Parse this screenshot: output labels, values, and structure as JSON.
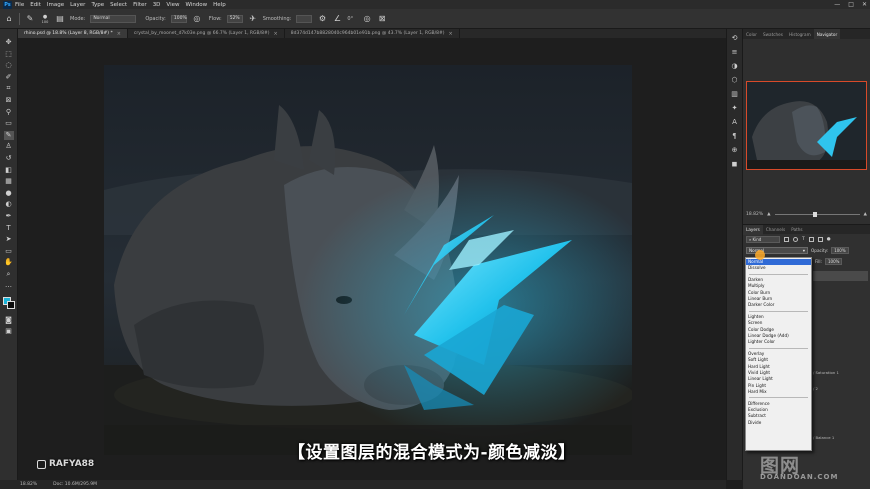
{
  "app": {
    "logo": "Ps"
  },
  "menu": [
    "File",
    "Edit",
    "Image",
    "Layer",
    "Type",
    "Select",
    "Filter",
    "3D",
    "View",
    "Window",
    "Help"
  ],
  "window_controls": [
    "—",
    "□",
    "✕"
  ],
  "options_bar": {
    "brush_size": "100",
    "mode_label": "Mode:",
    "mode_value": "Normal",
    "opacity_label": "Opacity:",
    "opacity_value": "100%",
    "flow_label": "Flow:",
    "flow_value": "52%",
    "smoothing_label": "Smoothing:",
    "smoothing_value": "",
    "angle_value": "0°"
  },
  "tabs": [
    {
      "label": "rhino.psd @ 18.8% (Layer 8, RGB/8#) *",
      "active": true
    },
    {
      "label": "crystal_by_moonet_d7k03e.png @ 66.7% (Layer 1, RGB/8#)",
      "active": false
    },
    {
      "label": "8d374d147b8828040c964b01e91b.png @ 43.7% (Layer 1, RGB/8#)",
      "active": false
    }
  ],
  "status": {
    "zoom": "18.82%",
    "doc": "Doc: 10.6M/295.9M"
  },
  "subtitle": "【设置图层的混合模式为-颜色减淡】",
  "watermark": "RAFYA88",
  "right_panel": {
    "top_tabs": [
      "Color",
      "Swatches",
      "Histogram",
      "Navigator"
    ],
    "active_top_tab": "Navigator",
    "zoom_value": "18.82%",
    "layer_tabs": [
      "Layers",
      "Channels",
      "Paths"
    ],
    "filter_kind": "Kind",
    "blend_mode": "Normal",
    "opacity_label": "Opacity:",
    "opacity_value": "100%",
    "fill_label": "Fill:",
    "fill_value": "100%",
    "lock_label": "Lock:",
    "layer_stubs": [
      "/ Saturation 1",
      "/ 2",
      "/ Balance 1"
    ]
  },
  "blend_menu": {
    "groups": [
      [
        "Normal",
        "Dissolve"
      ],
      [
        "Darken",
        "Multiply",
        "Color Burn",
        "Linear Burn",
        "Darker Color"
      ],
      [
        "Lighten",
        "Screen",
        "Color Dodge",
        "Linear Dodge (Add)",
        "Lighter Color"
      ],
      [
        "Overlay",
        "Soft Light",
        "Hard Light",
        "Vivid Light",
        "Linear Light",
        "Pin Light",
        "Hard Mix"
      ],
      [
        "Difference",
        "Exclusion",
        "Subtract",
        "Divide"
      ]
    ],
    "selected": "Normal"
  },
  "site_watermark": {
    "big": "图网",
    "small": "DOANDOAN.COM"
  },
  "colors": {
    "foreground": "#1bb3d8",
    "background": "#0c0c0c",
    "crystal": "#29c6ee",
    "navigator_border": "#d84a2a"
  }
}
